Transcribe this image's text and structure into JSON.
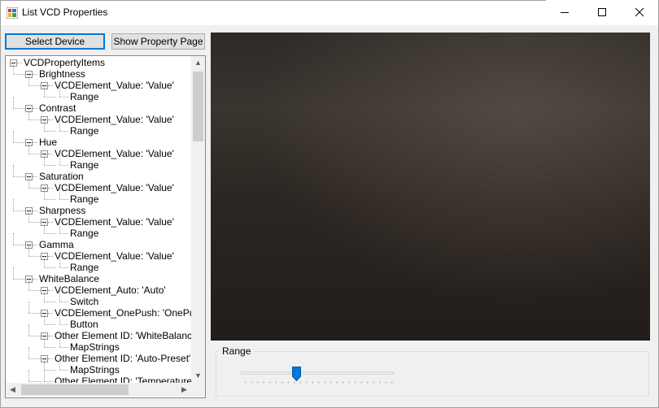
{
  "window": {
    "title": "List VCD Properties",
    "controls": [
      "minimize",
      "maximize",
      "close"
    ]
  },
  "toolbar": {
    "select_device": "Select Device",
    "show_property_page": "Show Property Page"
  },
  "tree": {
    "nodes": [
      {
        "label": "VCDPropertyItems",
        "level": 0
      },
      {
        "label": "Brightness",
        "level": 1
      },
      {
        "label": "VCDElement_Value: 'Value'",
        "level": 2
      },
      {
        "label": "Range",
        "level": 3
      },
      {
        "label": "Contrast",
        "level": 1
      },
      {
        "label": "VCDElement_Value: 'Value'",
        "level": 2
      },
      {
        "label": "Range",
        "level": 3
      },
      {
        "label": "Hue",
        "level": 1
      },
      {
        "label": "VCDElement_Value: 'Value'",
        "level": 2
      },
      {
        "label": "Range",
        "level": 3
      },
      {
        "label": "Saturation",
        "level": 1
      },
      {
        "label": "VCDElement_Value: 'Value'",
        "level": 2
      },
      {
        "label": "Range",
        "level": 3
      },
      {
        "label": "Sharpness",
        "level": 1
      },
      {
        "label": "VCDElement_Value: 'Value'",
        "level": 2
      },
      {
        "label": "Range",
        "level": 3
      },
      {
        "label": "Gamma",
        "level": 1
      },
      {
        "label": "VCDElement_Value: 'Value'",
        "level": 2
      },
      {
        "label": "Range",
        "level": 3
      },
      {
        "label": "WhiteBalance",
        "level": 1
      },
      {
        "label": "VCDElement_Auto: 'Auto'",
        "level": 2
      },
      {
        "label": "Switch",
        "level": 3
      },
      {
        "label": "VCDElement_OnePush: 'OnePush'",
        "level": 2
      },
      {
        "label": "Button",
        "level": 3
      },
      {
        "label": "Other Element ID: 'WhiteBalance",
        "level": 2
      },
      {
        "label": "MapStrings",
        "level": 3
      },
      {
        "label": "Other Element ID: 'Auto-Preset'",
        "level": 2
      },
      {
        "label": "MapStrings",
        "level": 3
      },
      {
        "label": "Other Element ID: 'Temperature",
        "level": 2
      }
    ]
  },
  "range_group": {
    "label": "Range",
    "slider_fraction": 0.36
  },
  "colors": {
    "accent": "#0078d7",
    "video_dark": "#221d1a",
    "window_bg": "#f0f0f0"
  }
}
